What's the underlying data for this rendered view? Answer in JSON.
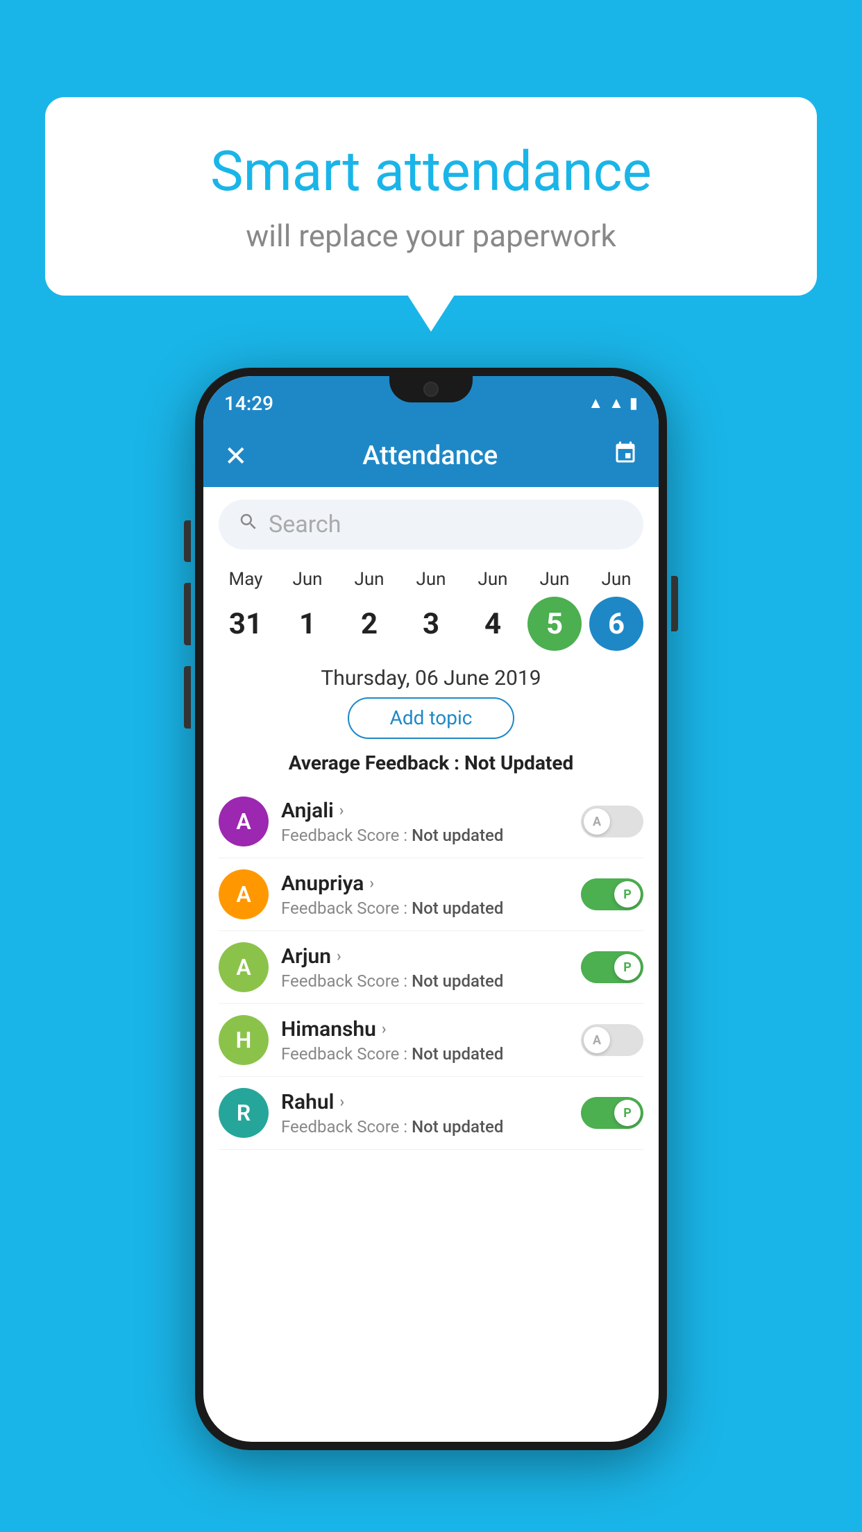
{
  "background": {
    "color": "#1ab5e8"
  },
  "speech_bubble": {
    "title": "Smart attendance",
    "subtitle": "will replace your paperwork"
  },
  "status_bar": {
    "time": "14:29",
    "wifi_icon": "▲",
    "signal_icon": "▲",
    "battery_icon": "▮"
  },
  "app_header": {
    "title": "Attendance",
    "close_label": "✕",
    "calendar_icon": "📅"
  },
  "search": {
    "placeholder": "Search"
  },
  "calendar": {
    "days": [
      {
        "month": "May",
        "date": "31",
        "state": "normal"
      },
      {
        "month": "Jun",
        "date": "1",
        "state": "normal"
      },
      {
        "month": "Jun",
        "date": "2",
        "state": "normal"
      },
      {
        "month": "Jun",
        "date": "3",
        "state": "normal"
      },
      {
        "month": "Jun",
        "date": "4",
        "state": "normal"
      },
      {
        "month": "Jun",
        "date": "5",
        "state": "today"
      },
      {
        "month": "Jun",
        "date": "6",
        "state": "selected"
      }
    ],
    "selected_date_label": "Thursday, 06 June 2019"
  },
  "add_topic": {
    "label": "Add topic"
  },
  "average_feedback": {
    "label": "Average Feedback :",
    "value": "Not Updated"
  },
  "students": [
    {
      "name": "Anjali",
      "avatar_letter": "A",
      "avatar_color": "#9c27b0",
      "feedback_label": "Feedback Score :",
      "feedback_value": "Not updated",
      "toggle": "off",
      "toggle_letter": "A"
    },
    {
      "name": "Anupriya",
      "avatar_letter": "A",
      "avatar_color": "#ff9800",
      "feedback_label": "Feedback Score :",
      "feedback_value": "Not updated",
      "toggle": "on",
      "toggle_letter": "P"
    },
    {
      "name": "Arjun",
      "avatar_letter": "A",
      "avatar_color": "#8bc34a",
      "feedback_label": "Feedback Score :",
      "feedback_value": "Not updated",
      "toggle": "on",
      "toggle_letter": "P"
    },
    {
      "name": "Himanshu",
      "avatar_letter": "H",
      "avatar_color": "#8bc34a",
      "feedback_label": "Feedback Score :",
      "feedback_value": "Not updated",
      "toggle": "off",
      "toggle_letter": "A"
    },
    {
      "name": "Rahul",
      "avatar_letter": "R",
      "avatar_color": "#26a69a",
      "feedback_label": "Feedback Score :",
      "feedback_value": "Not updated",
      "toggle": "on",
      "toggle_letter": "P"
    }
  ]
}
